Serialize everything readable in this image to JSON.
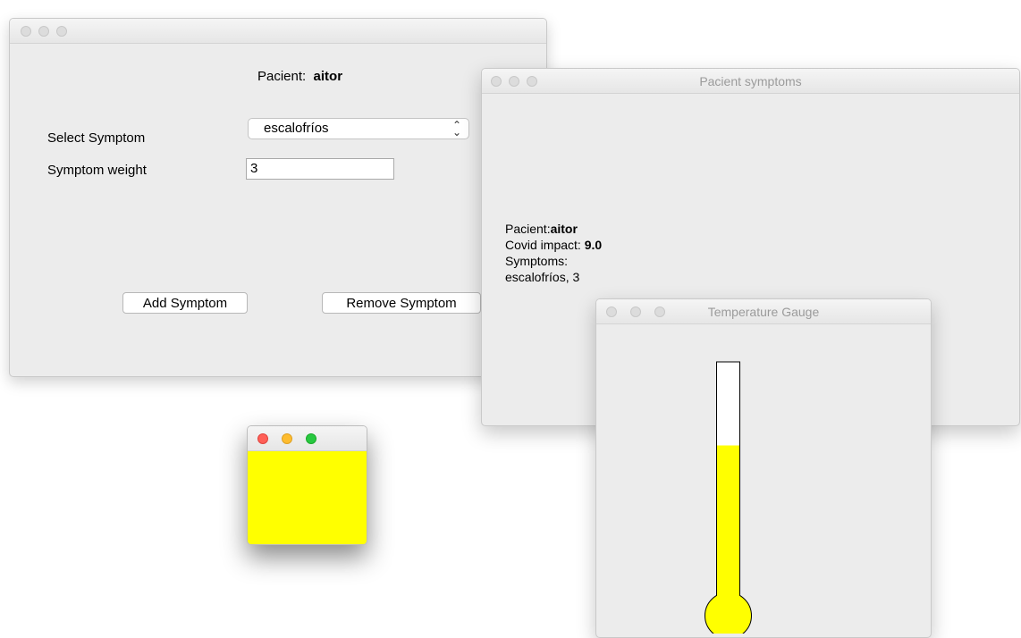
{
  "form_window": {
    "patient_label": "Pacient:",
    "patient_name": "aitor",
    "select_symptom_label": "Select Symptom",
    "selected_symptom": "escalofríos",
    "symptom_weight_label": "Symptom weight",
    "symptom_weight_value": "3",
    "add_button": "Add Symptom",
    "remove_button": "Remove Symptom"
  },
  "symptoms_window": {
    "title": "Pacient symptoms",
    "patient_label": "Pacient:",
    "patient_name": "aitor",
    "covid_impact_label": "Covid impact: ",
    "covid_impact_value": "9.0",
    "symptoms_label": "Symptoms:",
    "symptoms_list": "escalofríos, 3"
  },
  "color_window": {
    "fill_color": "#ffff00"
  },
  "gauge_window": {
    "title": "Temperature Gauge",
    "fill_color": "#ffff00",
    "fill_level": 0.64
  },
  "colors": {
    "close": "#ff5f57",
    "minimize": "#febc2e",
    "zoom": "#28c840"
  }
}
